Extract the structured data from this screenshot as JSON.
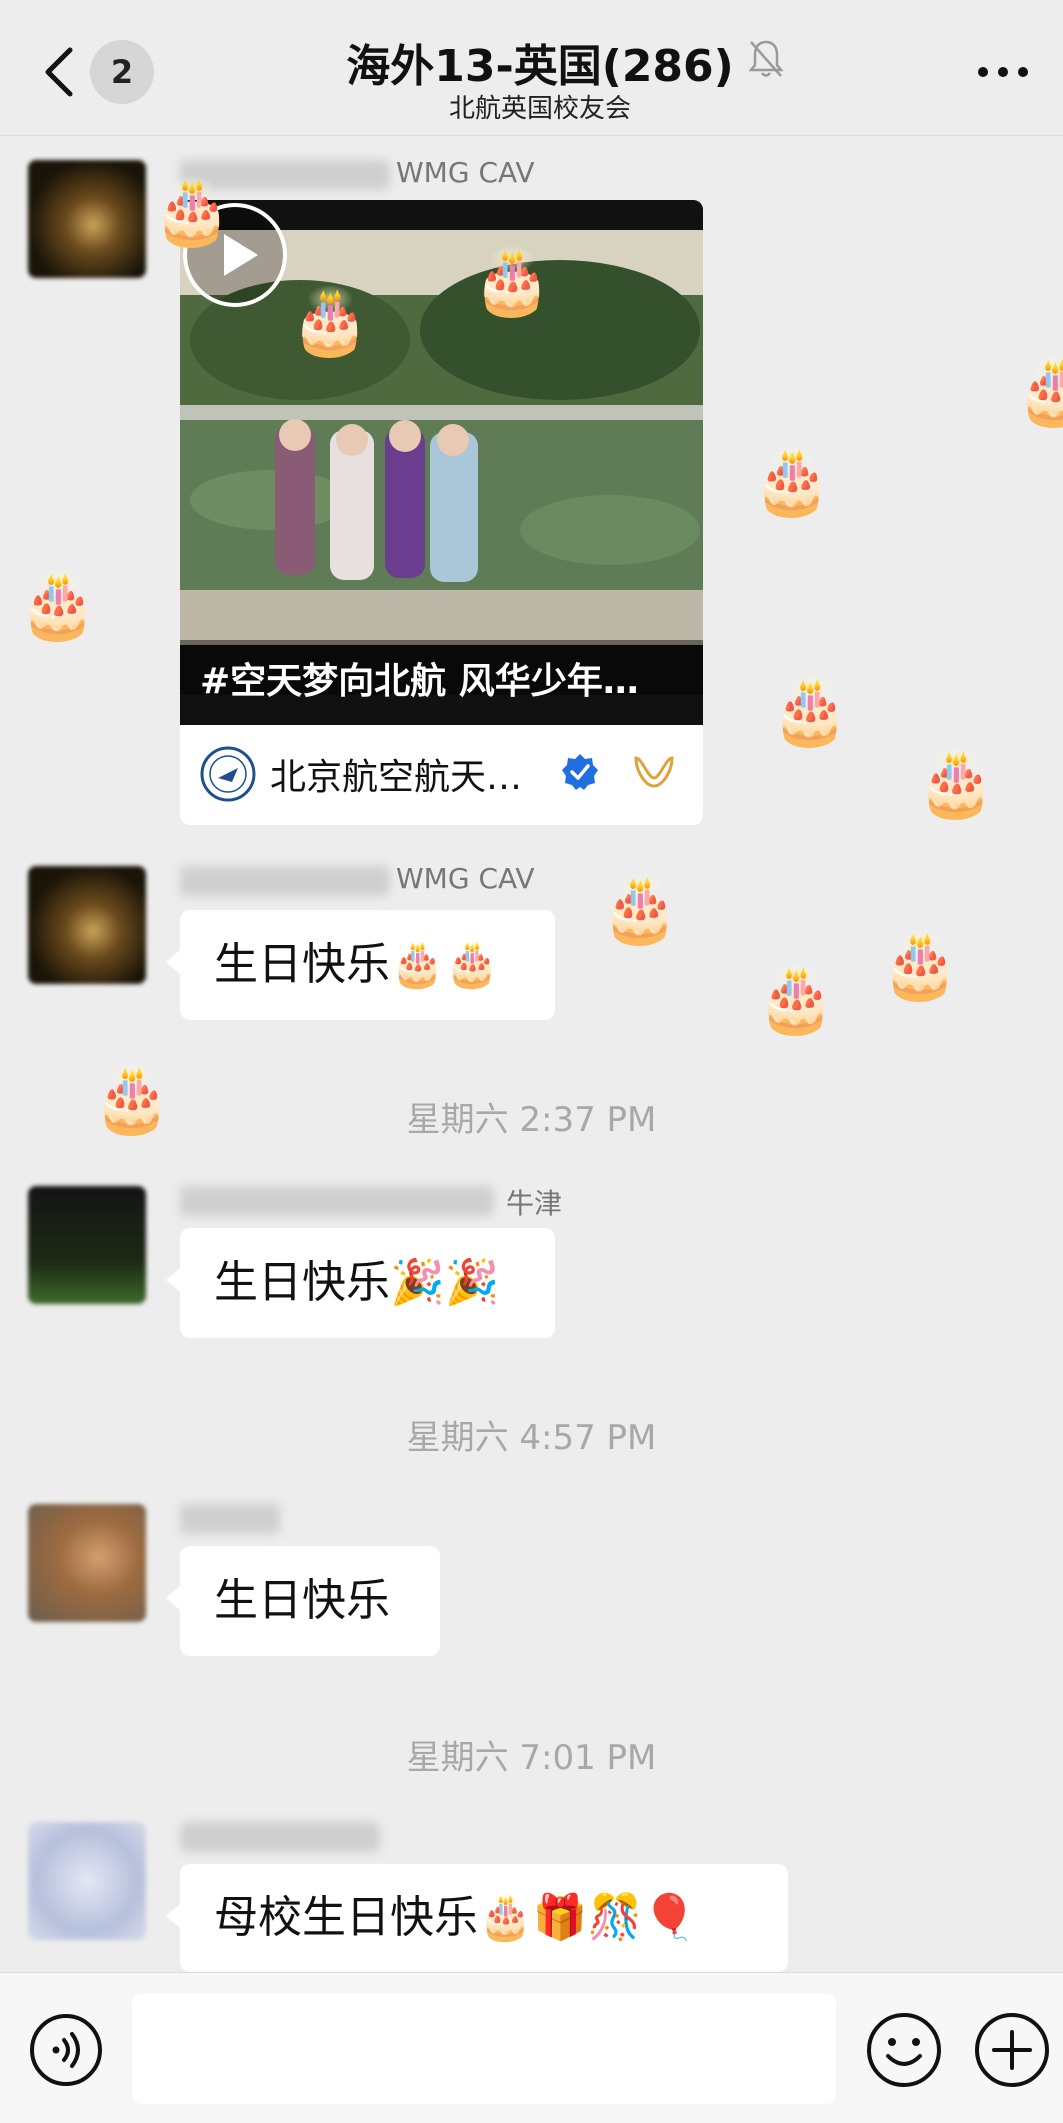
{
  "header": {
    "unread_count": "2",
    "title": "海外13-英国(286)",
    "subtitle": "北航英国校友会"
  },
  "messages": [
    {
      "nickname_visible": "WMG CAV",
      "video_card": {
        "caption": "#空天梦向北航 风华少年…",
        "source_name": "北京航空航天…"
      }
    },
    {
      "nickname_visible": "WMG CAV",
      "text": "生日快乐🎂🎂"
    },
    {
      "nickname_visible": "牛津",
      "text": "生日快乐🎉🎉"
    },
    {
      "nickname_visible": "",
      "text": "生日快乐"
    },
    {
      "nickname_visible": "",
      "text": "母校生日快乐🎂🎁🎊🎈"
    }
  ],
  "timestamps": [
    "星期六 2:37 PM",
    "星期六 4:57 PM",
    "星期六 7:01 PM"
  ],
  "icons": {
    "back": "chevron-left-icon",
    "mute": "bell-muted-icon",
    "more": "more-dots-icon",
    "voice": "voice-input-icon",
    "emoji": "emoji-icon",
    "plus": "plus-icon",
    "floating_effect": "🎂"
  },
  "colors": {
    "chat_background": "#ededed",
    "bubble": "#ffffff",
    "verified_badge": "#1f6fe0",
    "channel_icon": "#e0a23a"
  }
}
